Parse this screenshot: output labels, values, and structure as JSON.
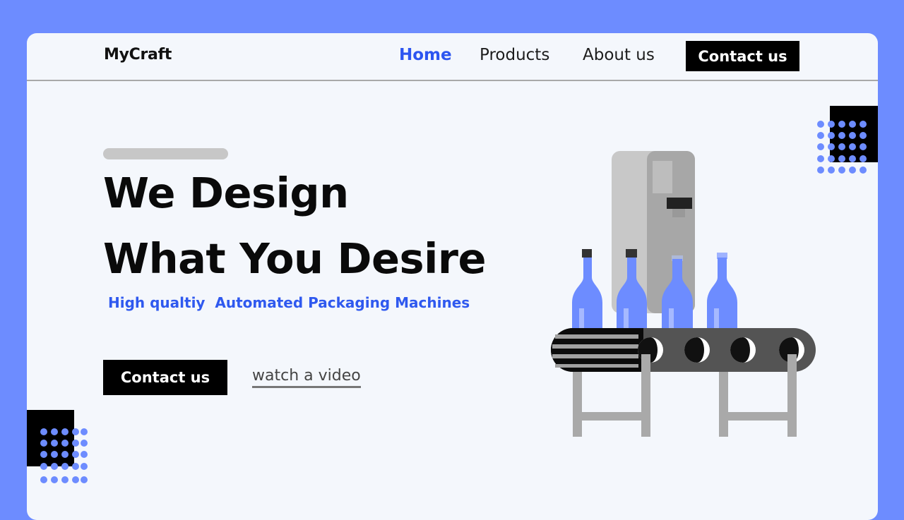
{
  "brand": {
    "name": "MyCraft"
  },
  "nav": {
    "items": [
      {
        "label": "Home",
        "active": true
      },
      {
        "label": "Products",
        "active": false
      },
      {
        "label": "About us",
        "active": false
      }
    ],
    "cta_label": "Contact us"
  },
  "hero": {
    "title_line1": "We Design",
    "title_line2": "What You Desire",
    "subtitle": "High qualtiy  Automated Packaging Machines",
    "cta_label": "Contact us",
    "video_link": "watch a video"
  },
  "icons": {
    "illustration": "bottle-conveyor-illustration",
    "decoration": "dot-grid-decoration"
  },
  "colors": {
    "background": "#6d8cff",
    "card": "#f4f7fc",
    "accent": "#2c55f0",
    "text": "#0a0a0a",
    "button": "#000000",
    "bottle": "#6d8cff"
  }
}
